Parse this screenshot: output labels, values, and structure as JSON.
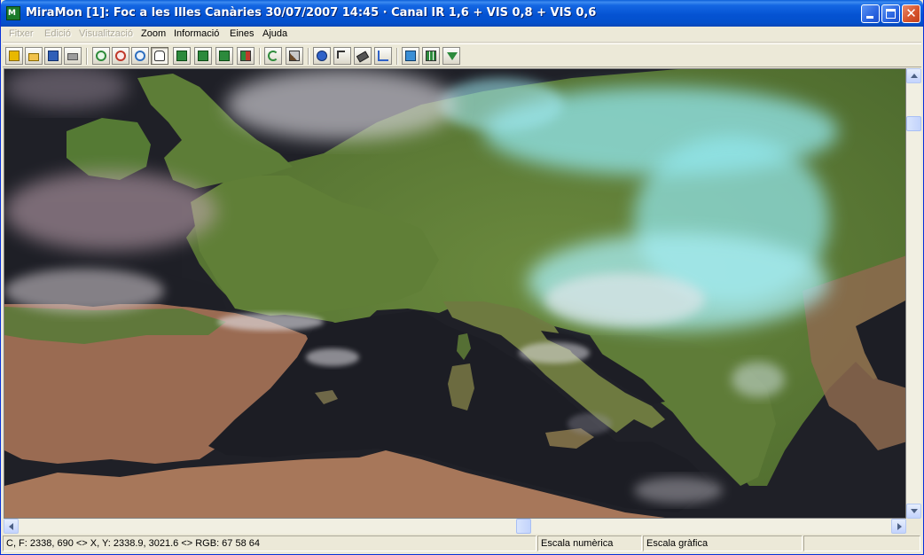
{
  "window": {
    "title": "MiraMon [1]:  Foc a les Illes Canàries 30/07/2007 14:45 · Canal IR 1,6 + VIS 0,8 + VIS 0,6",
    "app_icon_text": "M"
  },
  "menu": {
    "fitxer": "Fitxer",
    "edicio": "Edició",
    "visualitzacio": "Visualització",
    "zoom": "Zoom",
    "informacio": "Informació",
    "eines": "Eines",
    "ajuda": "Ajuda"
  },
  "toolbar": {
    "tools": [
      "new-icon",
      "open-icon",
      "save-icon",
      "print-icon",
      "zoom-in-icon",
      "zoom-out-icon",
      "zoom-window-icon",
      "pan-hand-icon",
      "view-extent-icon",
      "view-previous-icon",
      "view-next-icon",
      "flag-icon",
      "refresh-icon",
      "tools-icon",
      "info-icon",
      "pointer-icon",
      "eraser-icon",
      "measure-icon",
      "layers-icon",
      "grid-icon",
      "download-icon"
    ],
    "pressed": "pan-hand-icon"
  },
  "scrollbars": {
    "vertical_position": 0.08,
    "horizontal_position": 0.58
  },
  "status": {
    "coordinates": "C, F: 2338, 690 <> X, Y: 2338.9, 3021.6 <> RGB:  67 58 64",
    "numeric_scale": "Escala numèrica",
    "graphic_scale": "Escala gràfica",
    "extra": ""
  },
  "colors": {
    "land": "#5e7c37",
    "land_arid": "#9a6a4f",
    "sea": "#1f2027",
    "cloud_cyan": "#93e8ef",
    "cloud_white": "#d8d6dc",
    "cloud_pink": "#c8aab8"
  }
}
